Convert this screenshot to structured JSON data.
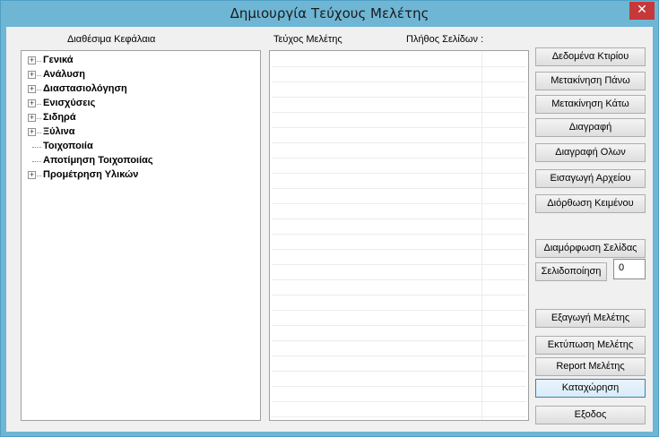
{
  "window": {
    "title": "Δημιουργία Τεύχους Μελέτης",
    "close_glyph": "✕"
  },
  "headers": {
    "available": "Διαθέσιμα Κεφάλαια",
    "study": "Τεύχος Μελέτης",
    "pages": "Πλήθος Σελίδων :"
  },
  "tree": {
    "items": [
      {
        "label": "Γενικά",
        "expandable": true,
        "expander": "+"
      },
      {
        "label": "Ανάλυση",
        "expandable": true,
        "expander": "+"
      },
      {
        "label": "Διαστασιολόγηση",
        "expandable": true,
        "expander": "+"
      },
      {
        "label": "Ενισχύσεις",
        "expandable": true,
        "expander": "+"
      },
      {
        "label": "Σιδηρά",
        "expandable": true,
        "expander": "+"
      },
      {
        "label": "Ξύλινα",
        "expandable": true,
        "expander": "+"
      },
      {
        "label": "Τοιχοποιία",
        "expandable": false
      },
      {
        "label": "Αποτίμηση Τοιχοποιίας",
        "expandable": false
      },
      {
        "label": "Προμέτρηση Υλικών",
        "expandable": true,
        "expander": "+"
      }
    ]
  },
  "buttons": {
    "building_data": "Δεδομένα Κτιρίου",
    "move_up": "Μετακίνηση Πάνω",
    "move_down": "Μετακίνηση Κάτω",
    "delete": "Διαγραφή",
    "delete_all": "Διαγραφή Ολων",
    "import_file": "Εισαγωγή Αρχείου",
    "edit_text": "Διόρθωση Κειμένου",
    "page_setup": "Διαμόρφωση Σελίδας",
    "pagination": "Σελιδοποίηση",
    "export_study": "Εξαγωγή Μελέτης",
    "print_study": "Εκτύπωση Μελέτης",
    "report_study": "Report Μελέτης",
    "register": "Καταχώρηση",
    "exit": "Εξοδος"
  },
  "pagination_start": "0"
}
